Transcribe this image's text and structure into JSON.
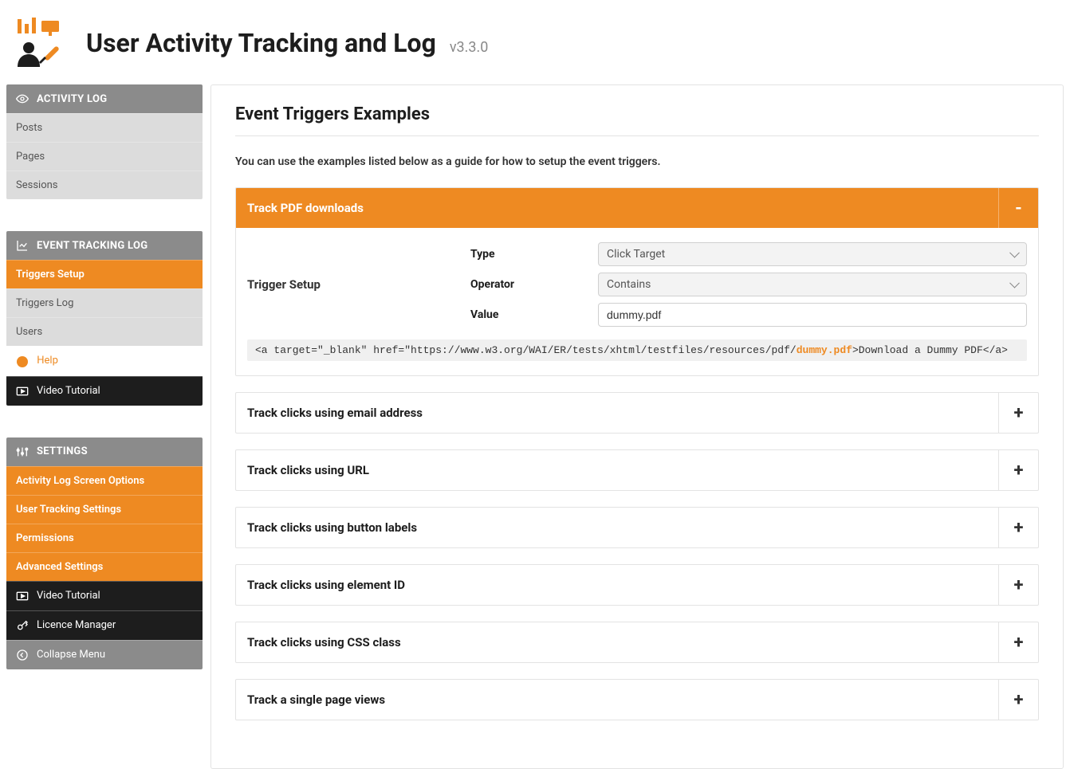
{
  "app": {
    "title": "User Activity Tracking and Log",
    "version": "v3.3.0"
  },
  "sidebar": {
    "groups": [
      {
        "header": "ACTIVITY LOG",
        "icon": "eye-icon",
        "items": [
          {
            "label": "Posts"
          },
          {
            "label": "Pages"
          },
          {
            "label": "Sessions"
          }
        ]
      },
      {
        "header": "EVENT TRACKING LOG",
        "icon": "chart-line-icon",
        "items": [
          {
            "label": "Triggers Setup",
            "active": true
          },
          {
            "label": "Triggers Log"
          },
          {
            "label": "Users"
          },
          {
            "label": "Help",
            "style": "help"
          },
          {
            "label": "Video Tutorial",
            "style": "dark",
            "icon": "video-icon"
          }
        ]
      },
      {
        "header": "SETTINGS",
        "icon": "sliders-icon",
        "items": [
          {
            "label": "Activity Log Screen Options",
            "active": true
          },
          {
            "label": "User Tracking Settings",
            "active": true
          },
          {
            "label": "Permissions",
            "active": true
          },
          {
            "label": "Advanced Settings",
            "active": true
          },
          {
            "label": "Video Tutorial",
            "style": "dark",
            "icon": "video-icon"
          },
          {
            "label": "Licence Manager",
            "style": "dark",
            "icon": "key-icon"
          },
          {
            "label": "Collapse Menu",
            "style": "gray-dark",
            "icon": "arrow-left-circle-icon"
          }
        ]
      }
    ]
  },
  "main": {
    "page_title": "Event Triggers Examples",
    "intro": "You can use the examples listed below as a guide for how to setup the event triggers.",
    "examples": [
      {
        "title": "Track PDF downloads",
        "expanded": true,
        "trigger_setup_label": "Trigger Setup",
        "type_label": "Type",
        "type_value": "Click Target",
        "operator_label": "Operator",
        "operator_value": "Contains",
        "value_label": "Value",
        "value_value": "dummy.pdf",
        "code_prefix": "<a target=\"_blank\" href=\"https://www.w3.org/WAI/ER/tests/xhtml/testfiles/resources/pdf/",
        "code_highlight": "dummy.pdf",
        "code_suffix": ">Download a Dummy PDF</a>"
      },
      {
        "title": "Track clicks using email address"
      },
      {
        "title": "Track clicks using URL"
      },
      {
        "title": "Track clicks using button labels"
      },
      {
        "title": "Track clicks using element ID"
      },
      {
        "title": "Track clicks using CSS class"
      },
      {
        "title": "Track a single page views"
      }
    ],
    "toggle_expand": "-",
    "toggle_collapse": "+"
  }
}
